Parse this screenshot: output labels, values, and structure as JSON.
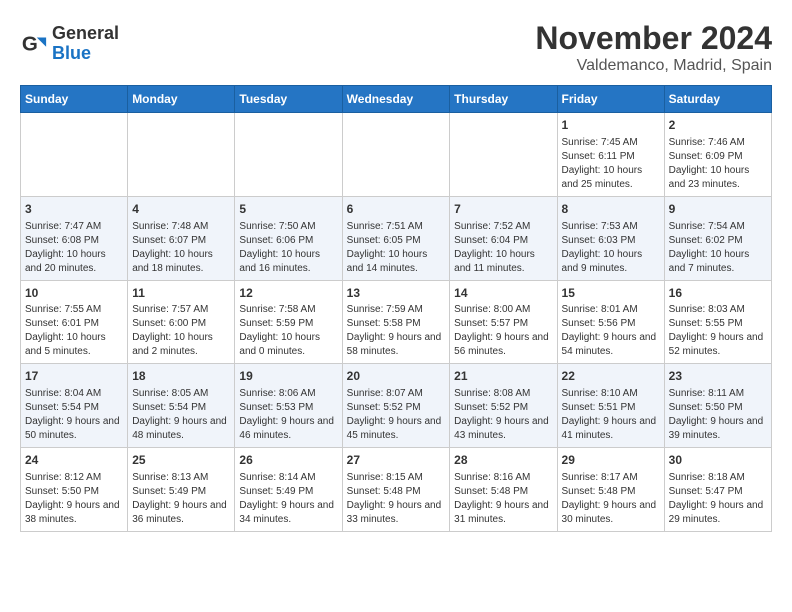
{
  "header": {
    "logo_line1": "General",
    "logo_line2": "Blue",
    "month_year": "November 2024",
    "location": "Valdemanco, Madrid, Spain"
  },
  "days_of_week": [
    "Sunday",
    "Monday",
    "Tuesday",
    "Wednesday",
    "Thursday",
    "Friday",
    "Saturday"
  ],
  "weeks": [
    [
      {
        "day": "",
        "content": ""
      },
      {
        "day": "",
        "content": ""
      },
      {
        "day": "",
        "content": ""
      },
      {
        "day": "",
        "content": ""
      },
      {
        "day": "",
        "content": ""
      },
      {
        "day": "1",
        "content": "Sunrise: 7:45 AM\nSunset: 6:11 PM\nDaylight: 10 hours and 25 minutes."
      },
      {
        "day": "2",
        "content": "Sunrise: 7:46 AM\nSunset: 6:09 PM\nDaylight: 10 hours and 23 minutes."
      }
    ],
    [
      {
        "day": "3",
        "content": "Sunrise: 7:47 AM\nSunset: 6:08 PM\nDaylight: 10 hours and 20 minutes."
      },
      {
        "day": "4",
        "content": "Sunrise: 7:48 AM\nSunset: 6:07 PM\nDaylight: 10 hours and 18 minutes."
      },
      {
        "day": "5",
        "content": "Sunrise: 7:50 AM\nSunset: 6:06 PM\nDaylight: 10 hours and 16 minutes."
      },
      {
        "day": "6",
        "content": "Sunrise: 7:51 AM\nSunset: 6:05 PM\nDaylight: 10 hours and 14 minutes."
      },
      {
        "day": "7",
        "content": "Sunrise: 7:52 AM\nSunset: 6:04 PM\nDaylight: 10 hours and 11 minutes."
      },
      {
        "day": "8",
        "content": "Sunrise: 7:53 AM\nSunset: 6:03 PM\nDaylight: 10 hours and 9 minutes."
      },
      {
        "day": "9",
        "content": "Sunrise: 7:54 AM\nSunset: 6:02 PM\nDaylight: 10 hours and 7 minutes."
      }
    ],
    [
      {
        "day": "10",
        "content": "Sunrise: 7:55 AM\nSunset: 6:01 PM\nDaylight: 10 hours and 5 minutes."
      },
      {
        "day": "11",
        "content": "Sunrise: 7:57 AM\nSunset: 6:00 PM\nDaylight: 10 hours and 2 minutes."
      },
      {
        "day": "12",
        "content": "Sunrise: 7:58 AM\nSunset: 5:59 PM\nDaylight: 10 hours and 0 minutes."
      },
      {
        "day": "13",
        "content": "Sunrise: 7:59 AM\nSunset: 5:58 PM\nDaylight: 9 hours and 58 minutes."
      },
      {
        "day": "14",
        "content": "Sunrise: 8:00 AM\nSunset: 5:57 PM\nDaylight: 9 hours and 56 minutes."
      },
      {
        "day": "15",
        "content": "Sunrise: 8:01 AM\nSunset: 5:56 PM\nDaylight: 9 hours and 54 minutes."
      },
      {
        "day": "16",
        "content": "Sunrise: 8:03 AM\nSunset: 5:55 PM\nDaylight: 9 hours and 52 minutes."
      }
    ],
    [
      {
        "day": "17",
        "content": "Sunrise: 8:04 AM\nSunset: 5:54 PM\nDaylight: 9 hours and 50 minutes."
      },
      {
        "day": "18",
        "content": "Sunrise: 8:05 AM\nSunset: 5:54 PM\nDaylight: 9 hours and 48 minutes."
      },
      {
        "day": "19",
        "content": "Sunrise: 8:06 AM\nSunset: 5:53 PM\nDaylight: 9 hours and 46 minutes."
      },
      {
        "day": "20",
        "content": "Sunrise: 8:07 AM\nSunset: 5:52 PM\nDaylight: 9 hours and 45 minutes."
      },
      {
        "day": "21",
        "content": "Sunrise: 8:08 AM\nSunset: 5:52 PM\nDaylight: 9 hours and 43 minutes."
      },
      {
        "day": "22",
        "content": "Sunrise: 8:10 AM\nSunset: 5:51 PM\nDaylight: 9 hours and 41 minutes."
      },
      {
        "day": "23",
        "content": "Sunrise: 8:11 AM\nSunset: 5:50 PM\nDaylight: 9 hours and 39 minutes."
      }
    ],
    [
      {
        "day": "24",
        "content": "Sunrise: 8:12 AM\nSunset: 5:50 PM\nDaylight: 9 hours and 38 minutes."
      },
      {
        "day": "25",
        "content": "Sunrise: 8:13 AM\nSunset: 5:49 PM\nDaylight: 9 hours and 36 minutes."
      },
      {
        "day": "26",
        "content": "Sunrise: 8:14 AM\nSunset: 5:49 PM\nDaylight: 9 hours and 34 minutes."
      },
      {
        "day": "27",
        "content": "Sunrise: 8:15 AM\nSunset: 5:48 PM\nDaylight: 9 hours and 33 minutes."
      },
      {
        "day": "28",
        "content": "Sunrise: 8:16 AM\nSunset: 5:48 PM\nDaylight: 9 hours and 31 minutes."
      },
      {
        "day": "29",
        "content": "Sunrise: 8:17 AM\nSunset: 5:48 PM\nDaylight: 9 hours and 30 minutes."
      },
      {
        "day": "30",
        "content": "Sunrise: 8:18 AM\nSunset: 5:47 PM\nDaylight: 9 hours and 29 minutes."
      }
    ]
  ]
}
